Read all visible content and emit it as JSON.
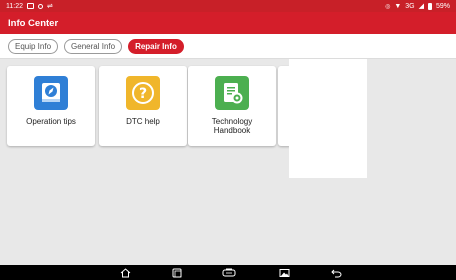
{
  "status_bar": {
    "time": "11:22",
    "network": "3G",
    "battery": "59%"
  },
  "header": {
    "title": "Info Center"
  },
  "tabs": [
    {
      "label": "Equip Info",
      "active": false
    },
    {
      "label": "General Info",
      "active": false
    },
    {
      "label": "Repair Info",
      "active": true
    }
  ],
  "cards": [
    {
      "label": "Operation tips",
      "icon": "compass-icon",
      "color": "#2f7fd6"
    },
    {
      "label": "DTC help",
      "icon": "question-icon",
      "color": "#f0b62b"
    },
    {
      "label": "Technology\nHandbook",
      "icon": "handbook-gear-icon",
      "color": "#4caf50"
    }
  ],
  "nav_bar": {
    "icons": [
      "home-icon",
      "recent-apps-icon",
      "vci-icon",
      "screenshot-icon",
      "back-icon"
    ]
  },
  "colors": {
    "brand_red": "#d41e2a",
    "background": "#e8e8e8"
  }
}
